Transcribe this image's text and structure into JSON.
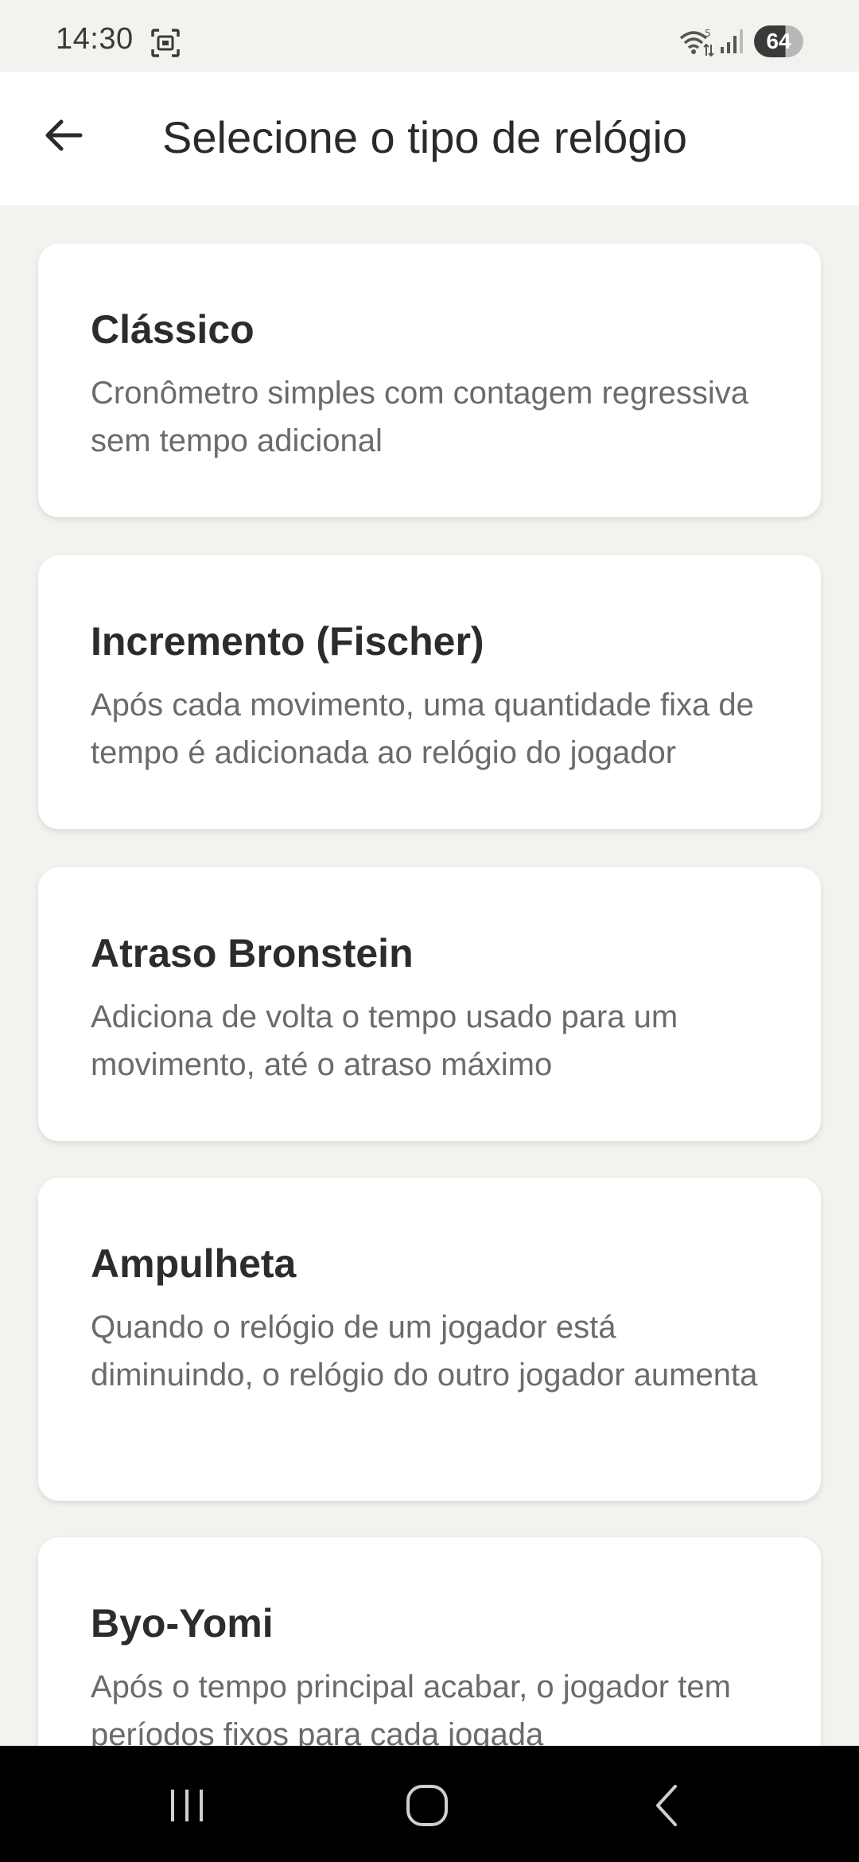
{
  "status_bar": {
    "time": "14:30",
    "battery": "64",
    "icons": [
      "screenshot-icon",
      "wifi-icon",
      "signal-icon"
    ]
  },
  "app_bar": {
    "title": "Selecione o tipo de relógio",
    "back_icon": "arrow-left-icon"
  },
  "clock_types": [
    {
      "title": "Clássico",
      "description": "Cronômetro simples com contagem regressiva sem tempo adicional"
    },
    {
      "title": "Incremento (Fischer)",
      "description": "Após cada movimento, uma quantidade fixa de tempo é adicionada ao relógio do jogador"
    },
    {
      "title": "Atraso Bronstein",
      "description": "Adiciona de volta o tempo usado para um movimento, até o atraso máximo"
    },
    {
      "title": "Ampulheta",
      "description": "Quando o relógio de um jogador está diminuindo, o relógio do outro jogador aumenta"
    },
    {
      "title": "Byo-Yomi",
      "description": "Após o tempo principal acabar, o jogador tem períodos fixos para cada jogada"
    }
  ],
  "nav_bar": {
    "icons": [
      "recent-apps-icon",
      "home-icon",
      "back-icon"
    ]
  },
  "colors": {
    "background": "#f2f2ef",
    "card": "#ffffff",
    "title_text": "#2c2c2c",
    "description_text": "#6b6b6b",
    "nav_bar": "#000000"
  }
}
